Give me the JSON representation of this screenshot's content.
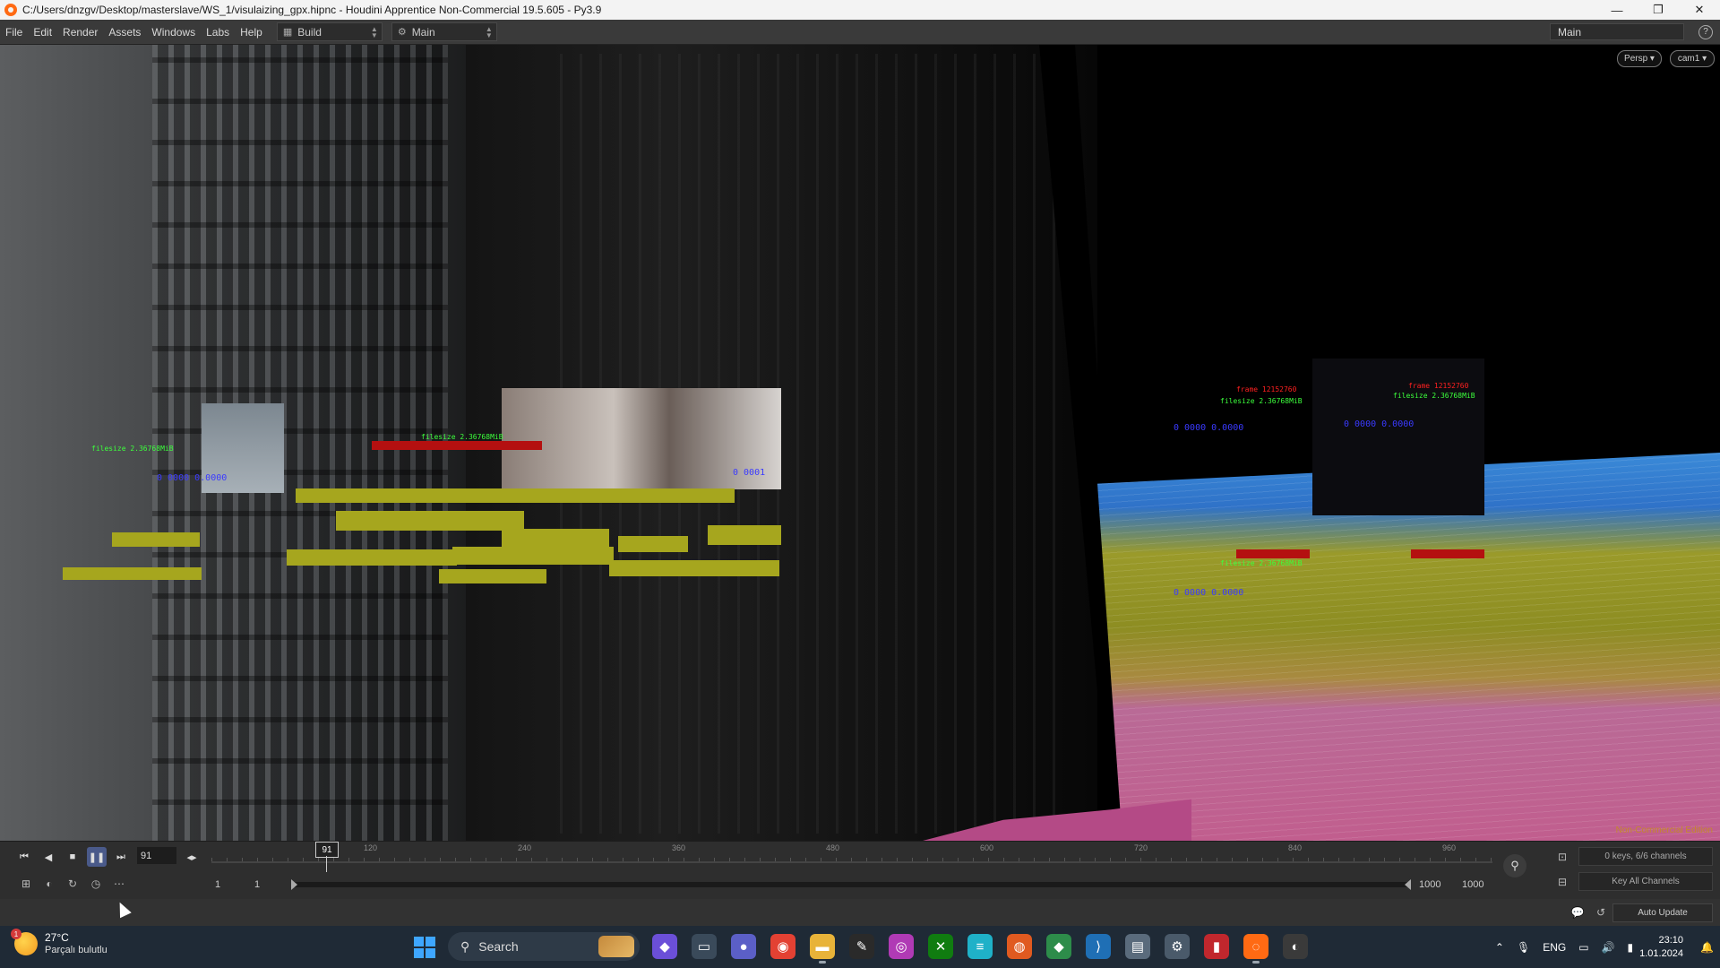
{
  "titlebar": {
    "title": "C:/Users/dnzgv/Desktop/masterslave/WS_1/visulaizing_gpx.hipnc - Houdini Apprentice Non-Commercial 19.5.605 - Py3.9",
    "minimize": "—",
    "maximize": "❐",
    "close": "✕"
  },
  "menubar": {
    "items": [
      "File",
      "Edit",
      "Render",
      "Assets",
      "Windows",
      "Labs",
      "Help"
    ],
    "desktop_build": "Build",
    "desktop_main": "Main",
    "right_desktop": "Main",
    "help": "?"
  },
  "viewport": {
    "view_persp": "Persp ▾",
    "view_cam": "cam1 ▾",
    "watermark": "Non-Commercial Edition",
    "labels_green": [
      "filesize 2.36768MiB",
      "filesize 2.36768MiB",
      "filesize 2.36768MiB",
      "filesize 2.36768MiB",
      "filesize 2.36768MiB"
    ],
    "labels_red": [
      "frame 12152760",
      "frame 12152760"
    ],
    "labels_blue": [
      "0 0000  0.0000",
      "0 0000  0.0000",
      "0 0000  0.0000",
      "0 0000  0.0000",
      "0 0001"
    ]
  },
  "timeline": {
    "current_frame": "91",
    "playhead_frame": "91",
    "ticks": [
      "120",
      "240",
      "360",
      "480",
      "600",
      "720",
      "840",
      "960"
    ],
    "range_start_a": "1",
    "range_start_b": "1",
    "range_end_a": "1000",
    "range_end_b": "1000",
    "keys_info": "0 keys, 6/6 channels",
    "key_all": "Key All Channels"
  },
  "statusbar": {
    "auto_update": "Auto Update"
  },
  "taskbar": {
    "weather_temp": "27°C",
    "weather_cond": "Parçalı bulutlu",
    "weather_badge": "1",
    "search_placeholder": "Search",
    "language": "ENG",
    "time": "23:10",
    "date": "1.01.2024"
  },
  "colors": {
    "accent_playback": "#4a5a8a",
    "data_bar": "#a6a61e",
    "label_green": "#3cff3c",
    "label_red": "#ff2020",
    "label_blue": "#3a3aff",
    "houdini_orange": "#ff6a13"
  }
}
